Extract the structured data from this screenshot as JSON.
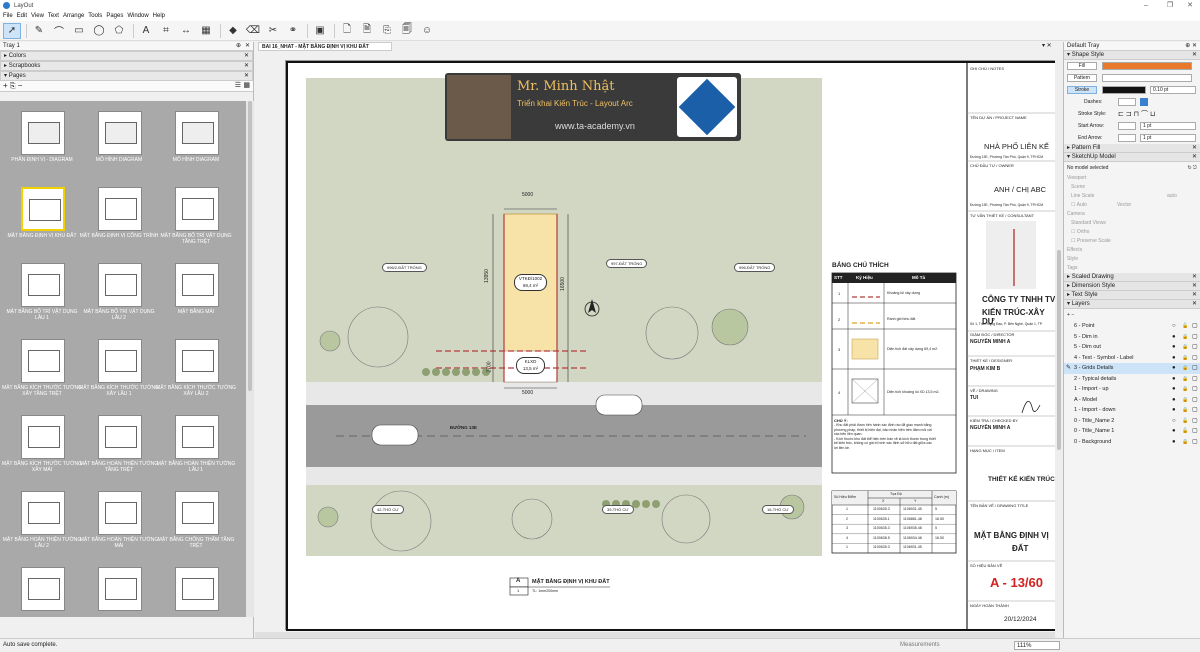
{
  "app": {
    "title": "LayOut",
    "menus": [
      "File",
      "Edit",
      "View",
      "Text",
      "Arrange",
      "Tools",
      "Pages",
      "Window",
      "Help"
    ],
    "accent": "#cde3f7"
  },
  "toolbar": {
    "icons": [
      "select-arrow-icon",
      "pencil-line-icon",
      "arc-icon",
      "rectangle-icon",
      "circle-icon",
      "polygon-icon",
      "text-icon",
      "label-icon",
      "dimension-icon",
      "table-icon",
      "style-icon",
      "eraser-icon",
      "split-icon",
      "join-icon",
      "sample-icon",
      "insert-page-icon",
      "add-page-icon",
      "duplicate-page-icon",
      "delete-page-icon",
      "user-icon"
    ]
  },
  "left_tray": {
    "title": "Tray 1",
    "panels": {
      "colors": "Colors",
      "scrapbooks": "Scrapbooks",
      "pages": "Pages"
    },
    "pages": [
      {
        "label": "PHÂN ĐỊNH VỊ - DIAGRAM"
      },
      {
        "label": "MÔ HÌNH DIAGRAM"
      },
      {
        "label": "MÔ HÌNH DIAGRAM"
      },
      {
        "label": "MẶT BẰNG ĐỊNH VỊ KHU ĐẤT"
      },
      {
        "label": "MẶT BẰNG ĐỊNH VỊ CÔNG TRÌNH"
      },
      {
        "label": "MẶT BẰNG BỐ TRÍ VẬT DỤNG TẦNG TRỆT"
      },
      {
        "label": "MẶT BẰNG BỐ TRÍ VẬT DỤNG LẦU 1"
      },
      {
        "label": "MẶT BẰNG BỐ TRÍ VẬT DỤNG LẦU 2"
      },
      {
        "label": "MẶT BẰNG MÁI"
      },
      {
        "label": "MẶT BẰNG KÍCH THƯỚC TƯỜNG XÂY TẦNG TRỆT"
      },
      {
        "label": "MẶT BẰNG KÍCH THƯỚC TƯỜNG XÂY LẦU 1"
      },
      {
        "label": "MẶT BẰNG KÍCH THƯỚC TƯỜNG XÂY LẦU 2"
      },
      {
        "label": "MẶT BẰNG KÍCH THƯỚC TƯỜNG XÂY MÁI"
      },
      {
        "label": "MẶT BẰNG HOÀN THIỆN TƯỜNG TẦNG TRỆT"
      },
      {
        "label": "MẶT BẰNG HOÀN THIỆN TƯỜNG LẦU 1"
      },
      {
        "label": "MẶT BẰNG HOÀN THIỆN TƯỜNG LẦU 2"
      },
      {
        "label": "MẶT BẰNG HOÀN THIỆN TƯỜNG MÁI"
      },
      {
        "label": "MẶT BẰNG CHỐNG THẤM TẦNG TRỆT"
      },
      {
        "label": ""
      },
      {
        "label": ""
      },
      {
        "label": ""
      }
    ]
  },
  "document_tab": "BAI 16_NHAT - MẶT BẰNG ĐỊNH VỊ KHU ĐẤT",
  "drawing": {
    "banner": {
      "name": "Mr. Minh Nhật",
      "subtitle": "Triển khai Kiến Trúc - Layout Arc",
      "website": "www.ta-academy.vn"
    },
    "dims": {
      "width_top": "5000",
      "width_bottom": "5000",
      "depth": "13950",
      "depth2": "16500",
      "front": "2700"
    },
    "lot_tag_1": "VTKĐ/1002",
    "lot_tag_1b": "69,4 m²",
    "lot_tag_2": "KLXD",
    "lot_tag_2b": "13,5 m²",
    "labels": {
      "l1": "996/2-ĐẤT TRỐNG",
      "l2": "997-ĐẤT TRỐNG",
      "l3": "996-ĐẤT TRỐNG",
      "road": "ĐƯỜNG 13E",
      "d1": "42-THỔ CƯ",
      "d2": "39-THỔ CƯ",
      "d3": "16-THỔ CƯ"
    },
    "legend": {
      "title": "BẢNG CHÚ THÍCH",
      "headers": [
        "STT",
        "Ký Hiệu",
        "Mô Tả"
      ],
      "rows": [
        {
          "stt": "1",
          "desc": "Khoảng lùi xây dựng"
        },
        {
          "stt": "2",
          "desc": "Ranh giới khu đất"
        },
        {
          "stt": "3",
          "desc": "Diện tích đất xây dựng 69,4 m2."
        },
        {
          "stt": "4",
          "desc": "Diện tích khoảng lùi XD 13,5 m2."
        }
      ],
      "note_title": "CHÚ Ý:",
      "note_lines": [
        "- Khu đất phải được tiến hành xác định rào đã giao mạnh bằng",
        "phương pháp, thiết bị hiện đại, bảo nhận hiện trên đâm môi với",
        "các bên liên quan.",
        "- Kích thước khu đất thể hiện trên bản vẽ là kích thước trung thiết",
        "kế kiến trúc, không có giá trị hình xác định sở hữu đất giữa các",
        "lợi liền kề."
      ]
    },
    "coords": {
      "headers": [
        "Số Hiệu Điểm",
        "Tọa Độ",
        "Cạnh (m)"
      ],
      "subheaders": [
        "X",
        "Y"
      ],
      "rows": [
        {
          "n": "1",
          "x": "1100635.3",
          "y": "1106931.45",
          "c": "5"
        },
        {
          "n": "2",
          "x": "1100635.1",
          "y": "1106881.48",
          "c": "16.50"
        },
        {
          "n": "3",
          "x": "1100635.3",
          "y": "1106935.48",
          "c": "5"
        },
        {
          "n": "4",
          "x": "1100638.5",
          "y": "1106934.48",
          "c": "16.50"
        },
        {
          "n": "1",
          "x": "1100635.3",
          "y": "1106931.45",
          "c": ""
        }
      ]
    },
    "caption": {
      "letter": "A",
      "title": "MẶT BẰNG ĐỊNH VỊ KHU ĐẤT",
      "num": "1",
      "scale": "TL: 1mm200mm"
    }
  },
  "titleblock": {
    "notes_label": "GHI CHÚ / NOTES",
    "project_label": "TÊN DỰ ÁN / PROJECT NAME",
    "project": "NHÀ PHỐ LIÊN KẾ",
    "address1": "Đường 13E, Phường Tân Phú, Quận 9, TP.HCM",
    "owner_label": "CHỦ ĐẦU TƯ / OWNER",
    "owner": "ANH / CHỊ ABC",
    "address2": "Đường 13E, Phường Tân Phú, Quận 9, TP.HCM",
    "consultant_label": "TƯ VẤN THIẾT KẾ / CONSULTANT",
    "company1": "CÔNG TY TNHH TV",
    "company2": "KIẾN TRÚC-XÂY DỰ",
    "company_addr": "Số 1, Trần Hưng Đạo, P. Bến Nghé, Quận 1, TP.",
    "director_label": "GIÁM ĐỐC / DIRECTOR",
    "director": "NGUYỄN MINH A",
    "designer_label": "THIẾT KẾ / DESIGNER",
    "designer": "PHẠM KIM B",
    "drawn_label": "VẼ / DRAWING",
    "drawn": "TUI",
    "checked_label": "KIỂM TRA / CHECKED BY",
    "checked": "NGUYỄN MINH A",
    "item_label": "HẠNG MỤC / ITEM",
    "item": "THIẾT KẾ KIẾN TRÚC",
    "title_label": "TÊN BẢN VẼ / DRAWING TITLE",
    "title1": "MẶT BẰNG ĐỊNH VỊ",
    "title2": "ĐẤT",
    "sheet_label": "SỐ HIỆU BẢN VẼ",
    "sheet_no": "A - 13/60",
    "date_label": "NGÀY HOÀN THÀNH",
    "date": "20/12/2024"
  },
  "right_tray": {
    "title": "Default Tray",
    "shape_style": "Shape Style",
    "fill": "Fill",
    "pattern": "Pattern",
    "stroke": "Stroke",
    "stroke_width": "0.10 pt",
    "dashes": "Dashes:",
    "stroke_style": "Stroke Style:",
    "start_arrow": "Start Arrow:",
    "end_arrow": "End Arrow:",
    "arrow_size": "1 pt",
    "pattern_fill": "Pattern Fill",
    "sketchup_model": "SketchUp Model",
    "no_model": "No model selected",
    "viewport": "Viewport",
    "scene": "Scene",
    "line_scale": "Line Scale",
    "auto": "auto",
    "auto_chk": "Auto",
    "vector": "Vector",
    "camera": "Camera",
    "standard_views": "Standard Views",
    "ortho": "Ortho",
    "preserve_scale": "Preserve Scale",
    "effects": "Effects",
    "style": "Style",
    "tags": "Tags",
    "scaled_drawing": "Scaled Drawing",
    "dimension_style": "Dimension Style",
    "text_style": "Text Style",
    "layers": "Layers",
    "layer_list": [
      "6 - Point",
      "5 - Dim in",
      "5 - Dim out",
      "4 - Text - Symbol - Label",
      "3 - Grids Details",
      "2 - Typical details",
      "1 - Import - up",
      "A - Model",
      "1 - Import - down",
      "0 - Title_Name 2",
      "0 - Title_Name 1",
      "0 - Background"
    ],
    "fill_color": "#e8782a"
  },
  "status": {
    "left": "Auto save complete.",
    "measure": "Measurements",
    "zoom": "111%"
  }
}
